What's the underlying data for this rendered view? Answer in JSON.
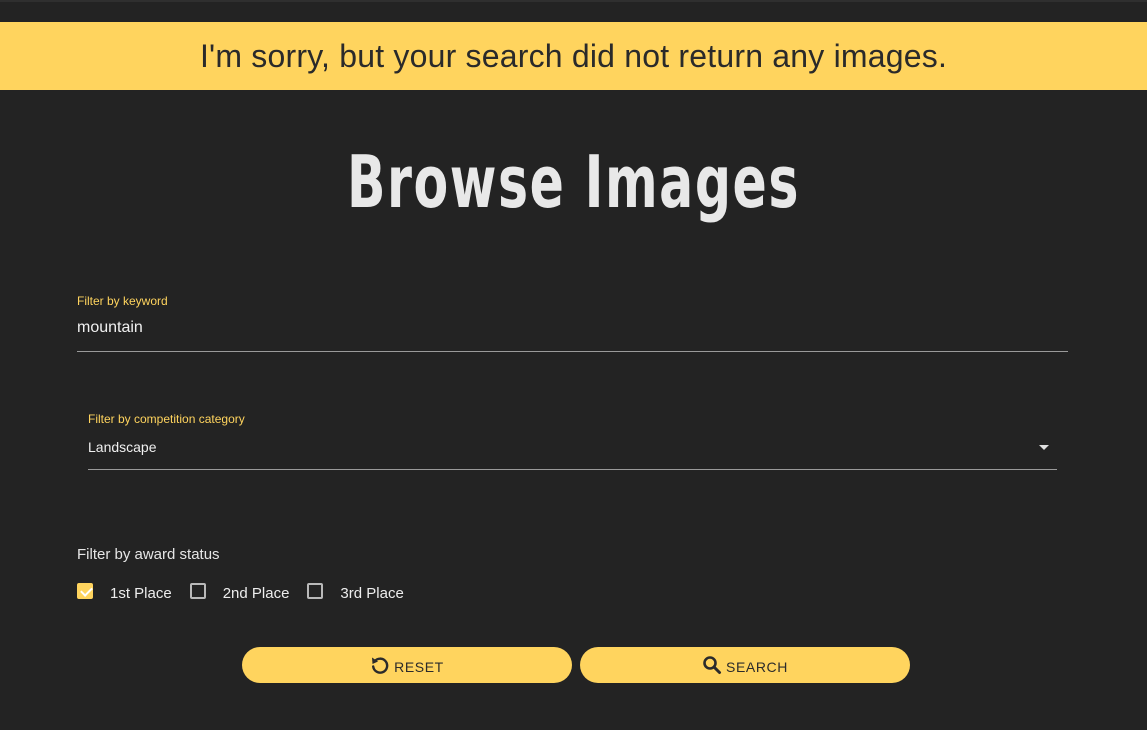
{
  "alert": {
    "message": "I'm sorry, but your search did not return any images."
  },
  "page": {
    "title": "Browse Images"
  },
  "filters": {
    "keyword": {
      "label": "Filter by keyword",
      "value": "mountain"
    },
    "category": {
      "label": "Filter by competition category",
      "selected": "Landscape",
      "icon": "dropdown-caret-icon"
    },
    "award": {
      "label": "Filter by award status",
      "options": [
        {
          "label": "1st Place",
          "checked": true
        },
        {
          "label": "2nd Place",
          "checked": false
        },
        {
          "label": "3rd Place",
          "checked": false
        }
      ]
    }
  },
  "actions": {
    "reset_label": "RESET",
    "reset_icon": "reset-icon",
    "search_label": "SEARCH",
    "search_icon": "search-icon"
  },
  "colors": {
    "background": "#232323",
    "accent": "#ffd45e",
    "text": "#e8e8e8"
  }
}
